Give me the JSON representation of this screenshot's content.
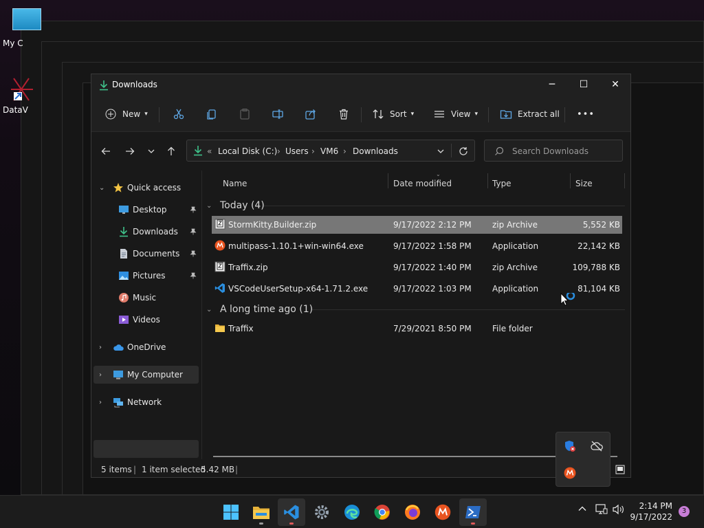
{
  "desktop": {
    "icons": [
      {
        "label": "My C"
      },
      {
        "label": "DataV"
      }
    ]
  },
  "window": {
    "title": "Downloads",
    "controls": {
      "minimize": "─",
      "maximize": "☐",
      "close": "✕"
    }
  },
  "commandbar": {
    "new_label": "New",
    "sort_label": "Sort",
    "view_label": "View",
    "extract_label": "Extract all",
    "more_label": "•••"
  },
  "address": {
    "overflow": "«",
    "crumbs": [
      "Local Disk (C:)",
      "Users",
      "VM6",
      "Downloads"
    ],
    "sep": "›"
  },
  "search": {
    "placeholder": "Search Downloads"
  },
  "sidebar": {
    "items": [
      {
        "label": "Quick access"
      },
      {
        "label": "Desktop"
      },
      {
        "label": "Downloads"
      },
      {
        "label": "Documents"
      },
      {
        "label": "Pictures"
      },
      {
        "label": "Music"
      },
      {
        "label": "Videos"
      },
      {
        "label": "OneDrive"
      },
      {
        "label": "My Computer"
      },
      {
        "label": "Network"
      }
    ]
  },
  "columns": {
    "name": "Name",
    "date": "Date modified",
    "type": "Type",
    "size": "Size"
  },
  "groups": [
    {
      "label": "Today (4)"
    },
    {
      "label": "A long time ago (1)"
    }
  ],
  "files": [
    {
      "name": "StormKitty.Builder.zip",
      "date": "9/17/2022 2:12 PM",
      "type": "zip Archive",
      "size": "5,552 KB"
    },
    {
      "name": "multipass-1.10.1+win-win64.exe",
      "date": "9/17/2022 1:58 PM",
      "type": "Application",
      "size": "22,142 KB"
    },
    {
      "name": "Traffix.zip",
      "date": "9/17/2022 1:40 PM",
      "type": "zip Archive",
      "size": "109,788 KB"
    },
    {
      "name": "VSCodeUserSetup-x64-1.71.2.exe",
      "date": "9/17/2022 1:03 PM",
      "type": "Application",
      "size": "81,104 KB"
    },
    {
      "name": "Traffix",
      "date": "7/29/2021 8:50 PM",
      "type": "File folder",
      "size": ""
    }
  ],
  "status": {
    "items": "5 items",
    "selected": "1 item selected",
    "selected_size": "5.42 MB",
    "bar": "|"
  },
  "clock": {
    "time": "2:14 PM",
    "date": "9/17/2022"
  },
  "notifications": {
    "count": "3"
  },
  "colors": {
    "selection": "#777777",
    "accent": "#4cc2ff",
    "folder": "#f0c042"
  }
}
